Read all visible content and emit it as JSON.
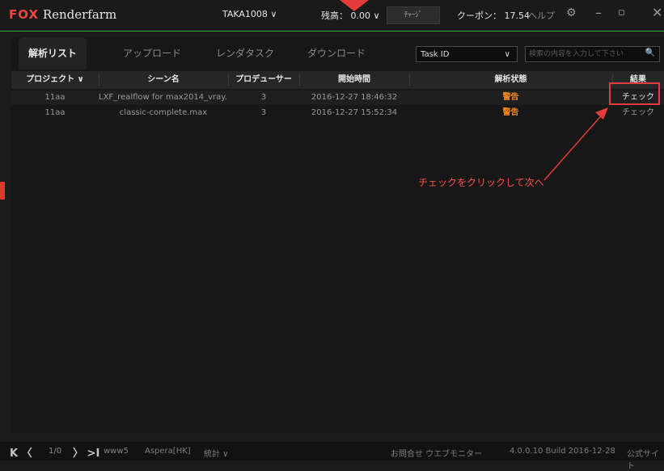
{
  "app": {
    "logo_brand": "FOX",
    "logo_name": "Renderfarm"
  },
  "titlebar": {
    "user": "TAKA1008 ∨",
    "balance": "残高： 0.00 ∨",
    "charge_label": "ﾁｬｰｼﾞ",
    "coupon": "クーポン： 17.54",
    "help_label": "ヘルプ",
    "gear_icon": "⚙",
    "minimize_icon": "–",
    "maximize_icon": "▫",
    "close_icon": "✕"
  },
  "tabs": [
    {
      "label": "解析リスト",
      "active": true
    },
    {
      "label": "アップロード"
    },
    {
      "label": "レンダタスク"
    },
    {
      "label": "ダウンロード"
    }
  ],
  "filter": {
    "selected": "Task ID",
    "chevron": "∨",
    "search_placeholder": "検索の内容を入力して下さい",
    "search_icon": "🔍"
  },
  "table": {
    "columns": [
      "プロジェクト ∨",
      "シーン名",
      "プロデューサー",
      "開始時間",
      "解析状態",
      "結果"
    ],
    "rows": [
      {
        "project": "11aa",
        "scene": "LXF_realflow for max2014_vray....",
        "producer": "3",
        "start": "2016-12-27 18:46:32",
        "status": "警告",
        "result": "チェック"
      },
      {
        "project": "11aa",
        "scene": "classic-complete.max",
        "producer": "3",
        "start": "2016-12-27 15:52:34",
        "status": "警告",
        "result": "チェック"
      }
    ]
  },
  "annotation": {
    "text": "チェックをクリックして次へ"
  },
  "statusbar": {
    "nav": "K 〈 〉 >I",
    "first": "K",
    "prev": "〈",
    "page": "1/0",
    "next": "〉",
    "last": ">I",
    "www": "www5",
    "aspera": "Aspera[HK]",
    "stats": "統計 ∨",
    "contact": "お問合せ ウエブモニター",
    "version": "4.0.0.10 Build 2016-12-28",
    "site": "公式サイト"
  },
  "colors": {
    "accent_green": "#3aa33a",
    "warning_orange": "#ff8a1c",
    "highlight_red": "#e53b3b"
  }
}
